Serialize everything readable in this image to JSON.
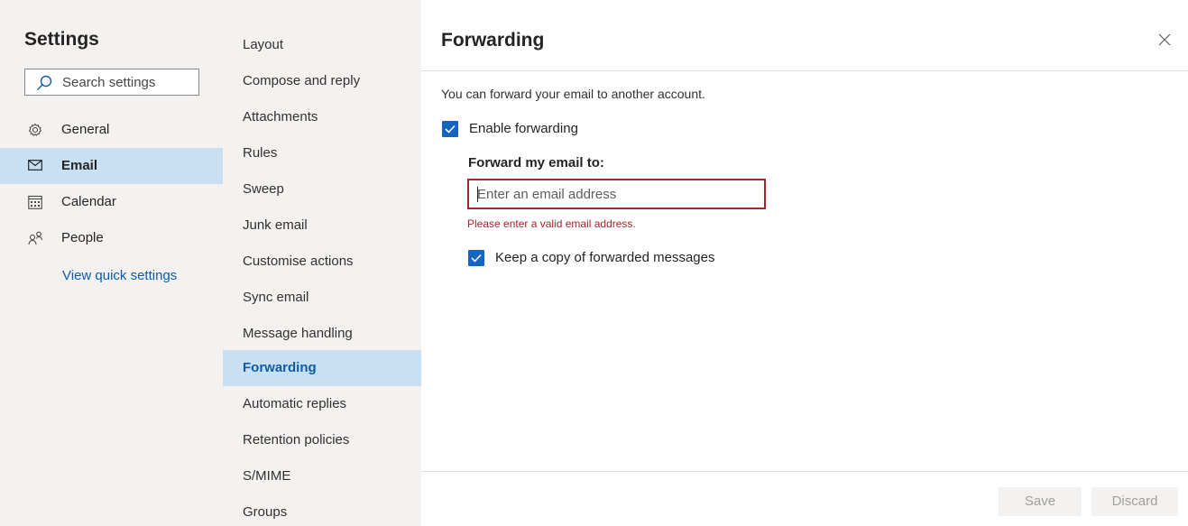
{
  "settings": {
    "title": "Settings",
    "search_placeholder": "Search settings",
    "nav": [
      {
        "label": "General",
        "icon": "gear-icon",
        "selected": false
      },
      {
        "label": "Email",
        "icon": "mail-icon",
        "selected": true
      },
      {
        "label": "Calendar",
        "icon": "calendar-icon",
        "selected": false
      },
      {
        "label": "People",
        "icon": "people-icon",
        "selected": false
      }
    ],
    "quick_settings_link": "View quick settings"
  },
  "categories": [
    "Layout",
    "Compose and reply",
    "Attachments",
    "Rules",
    "Sweep",
    "Junk email",
    "Customise actions",
    "Sync email",
    "Message handling",
    "Forwarding",
    "Automatic replies",
    "Retention policies",
    "S/MIME",
    "Groups"
  ],
  "selected_category": "Forwarding",
  "panel": {
    "title": "Forwarding",
    "description": "You can forward your email to another account.",
    "enable_forwarding": {
      "label": "Enable forwarding",
      "checked": true
    },
    "forward_to_label": "Forward my email to:",
    "email_input": {
      "value": "",
      "placeholder": "Enter an email address"
    },
    "error": "Please enter a valid email address.",
    "keep_copy": {
      "label": "Keep a copy of forwarded messages",
      "checked": true
    },
    "save_label": "Save",
    "discard_label": "Discard"
  },
  "colors": {
    "accent": "#1565c0",
    "selected_bg": "#c7e0f4",
    "error": "#a4262c",
    "link": "#0f5ba8"
  }
}
